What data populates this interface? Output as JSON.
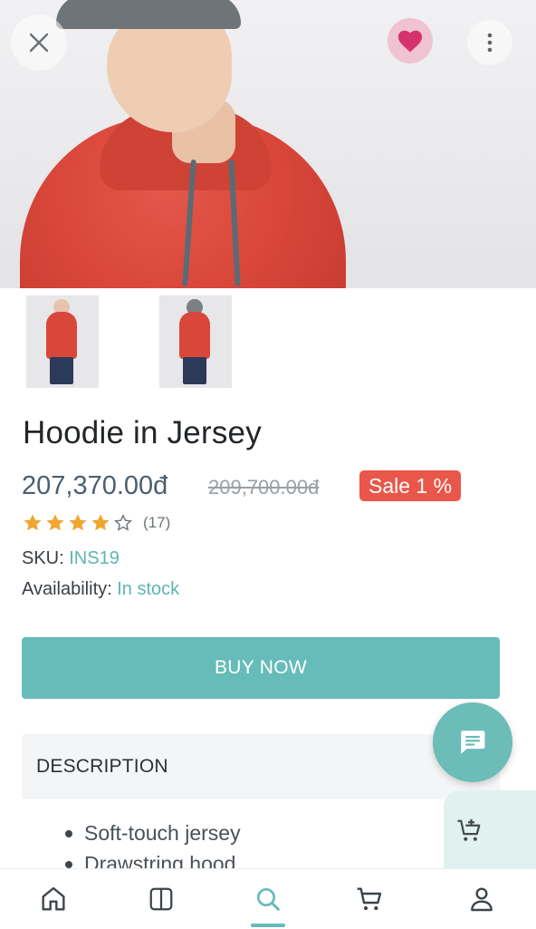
{
  "product": {
    "title": "Hoodie in Jersey",
    "price": "207,370.00đ",
    "old_price": "209,700.00đ",
    "sale_badge": "Sale 1 %",
    "rating": 4,
    "rating_max": 5,
    "review_count": "(17)",
    "sku_label": "SKU:",
    "sku_value": "INS19",
    "availability_label": "Availability:",
    "availability_value": "In stock"
  },
  "actions": {
    "buy_now": "BUY NOW"
  },
  "description": {
    "label": "DESCRIPTION",
    "bullets": [
      "Soft-touch jersey",
      "Drawstring hood"
    ]
  },
  "icons": {
    "close": "close-icon",
    "favorite": "heart-icon",
    "more": "more-vertical-icon",
    "chat": "chat-icon",
    "add_to_cart": "cart-plus-icon",
    "nav_home": "home-icon",
    "nav_categories": "columns-icon",
    "nav_search": "search-icon",
    "nav_cart": "cart-icon",
    "nav_account": "user-icon"
  },
  "colors": {
    "accent": "#66bcb9",
    "sale": "#e9574a",
    "favorite": "#d6336c",
    "star": "#f0a630"
  }
}
